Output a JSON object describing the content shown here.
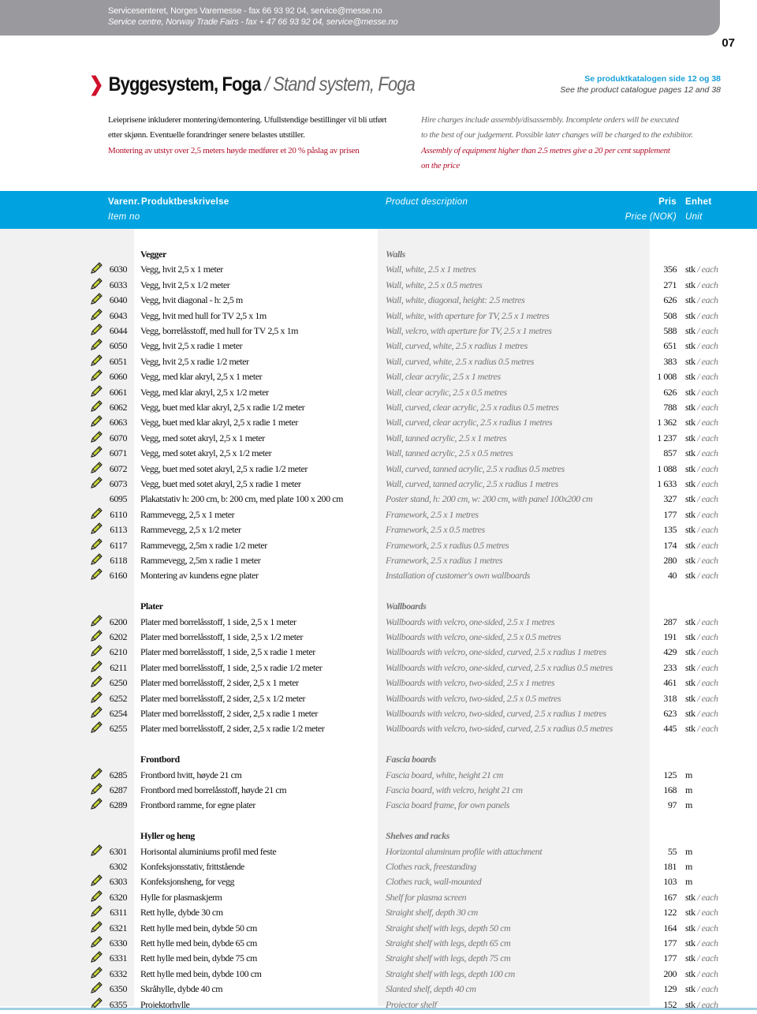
{
  "topbar": {
    "line_no": "Servicesenteret, Norges Varemesse - fax 66 93 92 04, service@messe.no",
    "line_en": "Service centre, Norway Trade Fairs - fax + 47 66 93 92 04, service@messe.no"
  },
  "page_number": "07",
  "title": {
    "no": "Byggesystem, Foga",
    "sep": " / ",
    "en": "Stand system, Foga"
  },
  "catalogue_ref": {
    "no": "Se produktkatalogen side 12 og 38",
    "en": "See the product catalogue pages 12 and 38"
  },
  "intro": {
    "no": [
      "Leieprisene inkluderer montering/demontering. Ufullstendige bestillinger vil bli utført",
      "etter skjønn. Eventuelle forandringer senere belastes utstiller."
    ],
    "no_red": "Montering av utstyr over 2,5 meters høyde medfører et 20 % påslag av prisen",
    "en": [
      "Hire charges include assembly/disassembly. Incomplete orders will be executed",
      "to the best of our judgement. Possible later changes will be charged to the exhibitor."
    ],
    "en_red": [
      "Assembly of equipment higher than 2.5 metres give a 20 per cent supplement",
      "on the price"
    ]
  },
  "table_header": {
    "item_no": "Varenr.",
    "item_no_en": "Item no",
    "desc_no": "Produktbeskrivelse",
    "desc_en": "Product description",
    "price": "Pris",
    "price_en": "Price (NOK)",
    "unit": "Enhet",
    "unit_en": "Unit"
  },
  "colors": {
    "accent_blue": "#00a3e0",
    "red": "#b0102a",
    "topbar_gray": "#9a9a9e"
  },
  "units": {
    "stk": "stk",
    "each": "/ each",
    "m": "m"
  },
  "sections": [
    {
      "no": "Vegger",
      "en": "Walls",
      "rows": [
        [
          "6030",
          "Vegg, hvit 2,5 x 1 meter",
          "Wall, white, 2.5 x 1 metres",
          "356",
          "stk",
          true
        ],
        [
          "6033",
          "Vegg, hvit 2,5 x 1/2 meter",
          "Wall, white, 2.5 x 0.5 metres",
          "271",
          "stk",
          true
        ],
        [
          "6040",
          "Vegg, hvit diagonal - h: 2,5 m",
          "Wall, white, diagonal, height: 2.5 metres",
          "626",
          "stk",
          true
        ],
        [
          "6043",
          "Vegg, hvit med hull for TV 2,5 x 1m",
          "Wall, white, with aperture for TV, 2.5 x 1 metres",
          "508",
          "stk",
          true
        ],
        [
          "6044",
          "Vegg, borrelåsstoff, med hull for TV 2,5 x 1m",
          "Wall, velcro, with aperture for TV, 2.5 x 1 metres",
          "588",
          "stk",
          true
        ],
        [
          "6050",
          "Vegg, hvit 2,5 x radie 1 meter",
          "Wall, curved, white, 2.5 x radius 1 metres",
          "651",
          "stk",
          true
        ],
        [
          "6051",
          "Vegg, hvit 2,5 x radie 1/2 meter",
          "Wall, curved, white, 2.5 x radius 0.5 metres",
          "383",
          "stk",
          true
        ],
        [
          "6060",
          "Vegg, med klar akryl, 2,5 x 1 meter",
          "Wall, clear acrylic, 2.5 x 1 metres",
          "1 008",
          "stk",
          true
        ],
        [
          "6061",
          "Vegg, med klar akryl, 2,5 x 1/2 meter",
          "Wall, clear acrylic, 2.5 x 0.5 metres",
          "626",
          "stk",
          true
        ],
        [
          "6062",
          "Vegg, buet med klar akryl, 2,5 x radie 1/2 meter",
          "Wall, curved, clear acrylic, 2.5 x radius 0.5 metres",
          "788",
          "stk",
          true
        ],
        [
          "6063",
          "Vegg, buet med klar akryl, 2,5 x radie 1 meter",
          "Wall, curved, clear acrylic, 2.5 x radius 1 metres",
          "1 362",
          "stk",
          true
        ],
        [
          "6070",
          "Vegg, med sotet akryl, 2,5 x 1 meter",
          "Wall, tanned acrylic, 2.5 x 1 metres",
          "1 237",
          "stk",
          true
        ],
        [
          "6071",
          "Vegg, med sotet akryl, 2,5 x 1/2 meter",
          "Wall, tanned acrylic, 2.5 x 0.5 metres",
          "857",
          "stk",
          true
        ],
        [
          "6072",
          "Vegg, buet med sotet akryl, 2,5 x radie 1/2 meter",
          "Wall, curved, tanned acrylic, 2.5 x radius 0.5 metres",
          "1 088",
          "stk",
          true
        ],
        [
          "6073",
          "Vegg, buet med sotet akryl, 2,5 x radie 1 meter",
          "Wall, curved, tanned acrylic, 2.5 x radius 1 metres",
          "1 633",
          "stk",
          true
        ],
        [
          "6095",
          "Plakatstativ h: 200 cm, b: 200 cm, med plate 100 x 200 cm",
          "Poster stand, h: 200 cm, w: 200 cm, with panel 100x200 cm",
          "327",
          "stk",
          false
        ],
        [
          "6110",
          "Rammevegg, 2,5 x 1 meter",
          "Framework, 2.5 x 1 metres",
          "177",
          "stk",
          true
        ],
        [
          "6113",
          "Rammevegg, 2,5 x 1/2 meter",
          "Framework, 2.5 x 0.5 metres",
          "135",
          "stk",
          true
        ],
        [
          "6117",
          "Rammevegg, 2,5m x radie 1/2 meter",
          "Framework, 2.5 x radius 0.5 metres",
          "174",
          "stk",
          true
        ],
        [
          "6118",
          "Rammevegg, 2,5m x radie 1 meter",
          "Framework, 2.5 x radius 1 metres",
          "280",
          "stk",
          true
        ],
        [
          "6160",
          "Montering av kundens egne plater",
          "Installation of customer's own wallboards",
          "40",
          "stk",
          true
        ]
      ]
    },
    {
      "no": "Plater",
      "en": "Wallboards",
      "rows": [
        [
          "6200",
          "Plater med borrelåsstoff, 1 side, 2,5 x 1 meter",
          "Wallboards with velcro, one-sided, 2.5 x 1 metres",
          "287",
          "stk",
          true
        ],
        [
          "6202",
          "Plater med borrelåsstoff, 1 side, 2,5 x 1/2 meter",
          "Wallboards with velcro, one-sided, 2.5 x 0.5 metres",
          "191",
          "stk",
          true
        ],
        [
          "6210",
          "Plater med borrelåsstoff, 1 side, 2,5 x radie 1 meter",
          "Wallboards with velcro, one-sided, curved, 2.5 x radius 1 metres",
          "429",
          "stk",
          true
        ],
        [
          "6211",
          "Plater med borrelåsstoff, 1 side, 2,5 x radie 1/2 meter",
          "Wallboards with velcro, one-sided, curved, 2.5 x radius 0.5 metres",
          "233",
          "stk",
          true
        ],
        [
          "6250",
          "Plater med borrelåsstoff, 2 sider, 2,5 x 1 meter",
          "Wallboards with velcro, two-sided, 2.5 x 1 metres",
          "461",
          "stk",
          true
        ],
        [
          "6252",
          "Plater med borrelåsstoff, 2 sider, 2,5 x 1/2 meter",
          "Wallboards with velcro, two-sided, 2.5 x 0.5 metres",
          "318",
          "stk",
          true
        ],
        [
          "6254",
          "Plater med borrelåsstoff, 2 sider, 2,5 x radie 1 meter",
          "Wallboards with velcro, two-sided, curved, 2.5 x radius 1 metres",
          "623",
          "stk",
          true
        ],
        [
          "6255",
          "Plater med borrelåsstoff, 2 sider, 2,5 x radie 1/2 meter",
          "Wallboards with velcro, two-sided, curved, 2.5 x radius 0.5 metres",
          "445",
          "stk",
          true
        ]
      ]
    },
    {
      "no": "Frontbord",
      "en": "Fascia boards",
      "rows": [
        [
          "6285",
          "Frontbord hvitt, høyde 21 cm",
          "Fascia board, white, height 21 cm",
          "125",
          "m",
          true
        ],
        [
          "6287",
          "Frontbord med borrelåsstoff, høyde 21 cm",
          "Fascia board, with velcro, height 21 cm",
          "168",
          "m",
          true
        ],
        [
          "6289",
          "Frontbord ramme, for egne plater",
          "Fascia board frame, for own panels",
          "97",
          "m",
          true
        ]
      ]
    },
    {
      "no": "Hyller og heng",
      "en": "Shelves and racks",
      "rows": [
        [
          "6301",
          "Horisontal aluminiums profil med feste",
          "Horizontal aluminum profile with attachment",
          "55",
          "m",
          true
        ],
        [
          "6302",
          "Konfeksjonsstativ, frittstående",
          "Clothes rack, freestanding",
          "181",
          "m",
          false
        ],
        [
          "6303",
          "Konfeksjonsheng, for vegg",
          "Clothes rack, wall-mounted",
          "103",
          "m",
          true
        ],
        [
          "6320",
          "Hylle for plasmaskjerm",
          "Shelf for plasma screen",
          "167",
          "stk",
          true
        ],
        [
          "6311",
          "Rett hylle, dybde 30 cm",
          "Straight shelf, depth 30 cm",
          "122",
          "stk",
          true
        ],
        [
          "6321",
          "Rett hylle med bein, dybde 50 cm",
          "Straight shelf with legs, depth 50 cm",
          "164",
          "stk",
          true
        ],
        [
          "6330",
          "Rett hylle med bein, dybde 65 cm",
          "Straight shelf with legs, depth 65 cm",
          "177",
          "stk",
          true
        ],
        [
          "6331",
          "Rett hylle med bein, dybde 75 cm",
          "Straight shelf with legs, depth 75 cm",
          "177",
          "stk",
          true
        ],
        [
          "6332",
          "Rett hylle med bein, dybde 100 cm",
          "Straight shelf with legs, depth 100 cm",
          "200",
          "stk",
          true
        ],
        [
          "6350",
          "Skråhylle, dybde 40 cm",
          "Slanted shelf, depth 40 cm",
          "129",
          "stk",
          true
        ],
        [
          "6355",
          "Projektorhylle",
          "Projector shelf",
          "152",
          "stk",
          true
        ]
      ]
    }
  ]
}
